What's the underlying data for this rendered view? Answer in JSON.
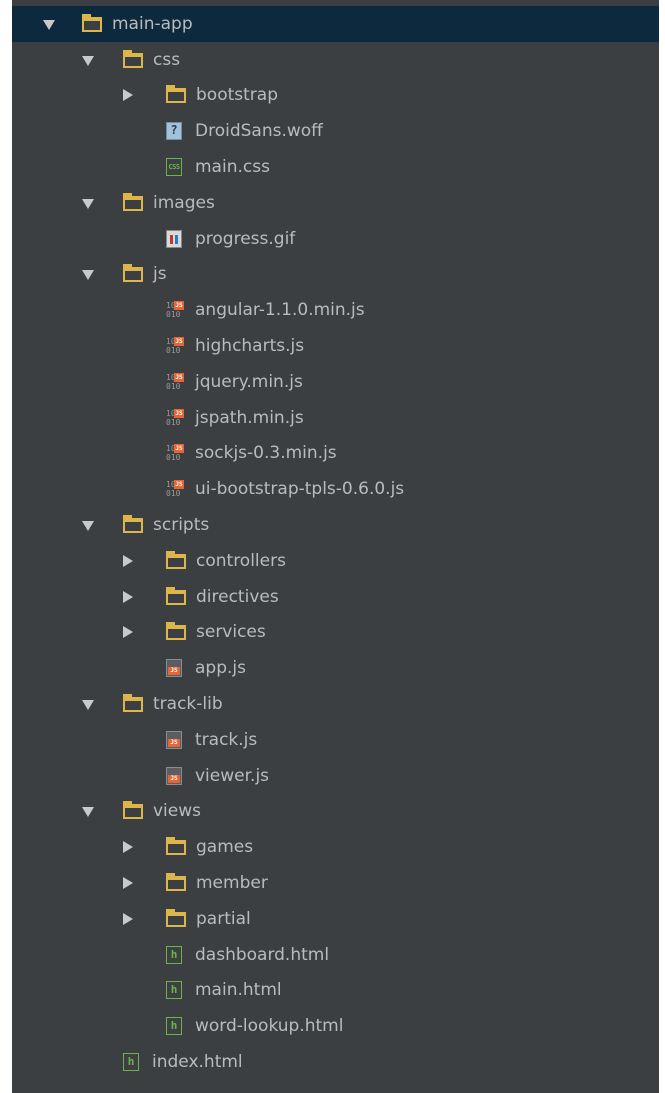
{
  "tree": [
    {
      "label": "main-app",
      "type": "folder",
      "depth": 0,
      "state": "expanded",
      "selected": true,
      "name": "tree-item-main-app"
    },
    {
      "label": "css",
      "type": "folder",
      "depth": 1,
      "state": "expanded",
      "name": "tree-item-css"
    },
    {
      "label": "bootstrap",
      "type": "folder",
      "depth": 2,
      "state": "collapsed",
      "name": "tree-item-bootstrap"
    },
    {
      "label": "DroidSans.woff",
      "type": "file-unknown",
      "depth": 2,
      "name": "tree-item-droidsans-woff"
    },
    {
      "label": "main.css",
      "type": "file-css",
      "depth": 2,
      "name": "tree-item-main-css"
    },
    {
      "label": "images",
      "type": "folder",
      "depth": 1,
      "state": "expanded",
      "name": "tree-item-images"
    },
    {
      "label": "progress.gif",
      "type": "file-image",
      "depth": 2,
      "name": "tree-item-progress-gif"
    },
    {
      "label": "js",
      "type": "folder",
      "depth": 1,
      "state": "expanded",
      "name": "tree-item-js"
    },
    {
      "label": "angular-1.1.0.min.js",
      "type": "file-minjs",
      "depth": 2,
      "name": "tree-item-angular-min-js"
    },
    {
      "label": "highcharts.js",
      "type": "file-minjs",
      "depth": 2,
      "name": "tree-item-highcharts-js"
    },
    {
      "label": "jquery.min.js",
      "type": "file-minjs",
      "depth": 2,
      "name": "tree-item-jquery-min-js"
    },
    {
      "label": "jspath.min.js",
      "type": "file-minjs",
      "depth": 2,
      "name": "tree-item-jspath-min-js"
    },
    {
      "label": "sockjs-0.3.min.js",
      "type": "file-minjs",
      "depth": 2,
      "name": "tree-item-sockjs-min-js"
    },
    {
      "label": "ui-bootstrap-tpls-0.6.0.js",
      "type": "file-minjs",
      "depth": 2,
      "name": "tree-item-ui-bootstrap-js"
    },
    {
      "label": "scripts",
      "type": "folder",
      "depth": 1,
      "state": "expanded",
      "name": "tree-item-scripts"
    },
    {
      "label": "controllers",
      "type": "folder",
      "depth": 2,
      "state": "collapsed",
      "name": "tree-item-controllers"
    },
    {
      "label": "directives",
      "type": "folder",
      "depth": 2,
      "state": "collapsed",
      "name": "tree-item-directives"
    },
    {
      "label": "services",
      "type": "folder",
      "depth": 2,
      "state": "collapsed",
      "name": "tree-item-services"
    },
    {
      "label": "app.js",
      "type": "file-js",
      "depth": 2,
      "name": "tree-item-app-js"
    },
    {
      "label": "track-lib",
      "type": "folder",
      "depth": 1,
      "state": "expanded",
      "name": "tree-item-track-lib"
    },
    {
      "label": "track.js",
      "type": "file-js",
      "depth": 2,
      "name": "tree-item-track-js"
    },
    {
      "label": "viewer.js",
      "type": "file-js",
      "depth": 2,
      "name": "tree-item-viewer-js"
    },
    {
      "label": "views",
      "type": "folder",
      "depth": 1,
      "state": "expanded",
      "name": "tree-item-views"
    },
    {
      "label": "games",
      "type": "folder",
      "depth": 2,
      "state": "collapsed",
      "name": "tree-item-games"
    },
    {
      "label": "member",
      "type": "folder",
      "depth": 2,
      "state": "collapsed",
      "name": "tree-item-member"
    },
    {
      "label": "partial",
      "type": "folder",
      "depth": 2,
      "state": "collapsed",
      "name": "tree-item-partial"
    },
    {
      "label": "dashboard.html",
      "type": "file-html",
      "depth": 2,
      "name": "tree-item-dashboard-html"
    },
    {
      "label": "main.html",
      "type": "file-html",
      "depth": 2,
      "name": "tree-item-main-html"
    },
    {
      "label": "word-lookup.html",
      "type": "file-html",
      "depth": 2,
      "name": "tree-item-word-lookup-html"
    },
    {
      "label": "index.html",
      "type": "file-html",
      "depth": 1,
      "name": "tree-item-index-html"
    }
  ],
  "glyphs": {
    "file_unknown": "?",
    "file_css": "CSS",
    "file_html": "h",
    "minjs_line1": "10",
    "minjs_line2": "010",
    "minjs_tag": "JS"
  },
  "colors": {
    "panel_background": "#3c3f41",
    "selection": "#0d293e",
    "text": "#bbbbbb",
    "folder": "#dcb54b",
    "js_badge": "#e66535",
    "html_css_badge": "#6cb24f"
  }
}
